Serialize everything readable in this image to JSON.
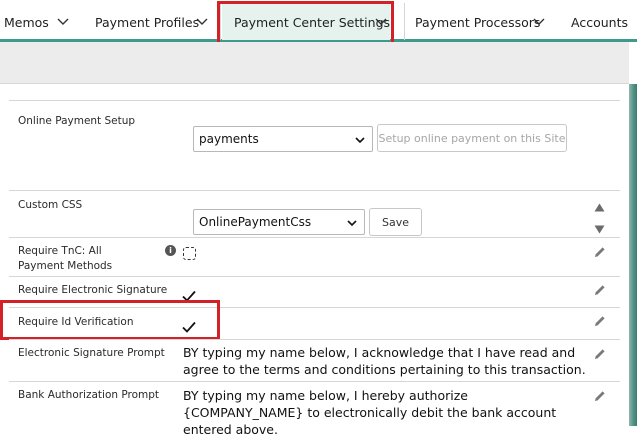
{
  "nav": {
    "items": [
      {
        "label": "Memos"
      },
      {
        "label": "Payment Profiles"
      },
      {
        "label": "Payment Center Settings"
      },
      {
        "label": "Payment Processors"
      },
      {
        "label": "Accounts"
      }
    ]
  },
  "settings": {
    "online_payment_setup": {
      "label": "Online Payment Setup",
      "select_value": "payments",
      "button_label": "Setup online payment on this Site"
    },
    "custom_css": {
      "label": "Custom CSS",
      "select_value": "OnlinePaymentCss",
      "button_label": "Save"
    },
    "require_tnc": {
      "label": "Require TnC: All Payment Methods",
      "info": "i"
    },
    "require_esig": {
      "label": "Require Electronic Signature"
    },
    "require_id": {
      "label": "Require Id Verification"
    },
    "esig_prompt": {
      "label": "Electronic Signature Prompt",
      "value": "BY typing my name below, I acknowledge that I have read and agree to the terms and conditions pertaining to this transaction."
    },
    "bank_prompt": {
      "label": "Bank Authorization Prompt",
      "value": "BY typing my name below, I hereby authorize {COMPANY_NAME} to electronically debit the bank account entered above."
    }
  },
  "colors": {
    "accent": "#3f9a8e",
    "highlight": "#d42027",
    "active_tab_bg": "#e6f2ee"
  }
}
